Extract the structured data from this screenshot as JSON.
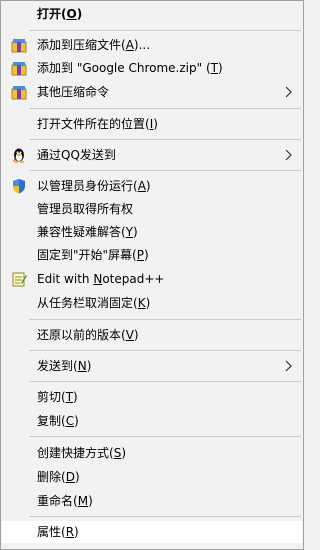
{
  "menu": {
    "open": {
      "label": "打开",
      "key": "O"
    },
    "add_archive": {
      "label": "添加到压缩文件",
      "key": "A",
      "suffix": "..."
    },
    "add_zip": {
      "label": "添加到 \"Google Chrome.zip\" ",
      "key": "T"
    },
    "other_compress": {
      "label": "其他压缩命令"
    },
    "open_location": {
      "label": "打开文件所在的位置",
      "key": "I"
    },
    "send_qq": {
      "label": "通过QQ发送到"
    },
    "run_admin": {
      "label": "以管理员身份运行",
      "key": "A"
    },
    "take_ownership": {
      "label": "管理员取得所有权"
    },
    "compat": {
      "label": "兼容性疑难解答",
      "key": "Y"
    },
    "pin_start": {
      "label": "固定到\"开始\"屏幕",
      "key": "P"
    },
    "notepad": {
      "label_pre": "Edit with ",
      "label_ul": "N",
      "label_post": "otepad++"
    },
    "unpin_taskbar": {
      "label": "从任务栏取消固定",
      "key": "K"
    },
    "restore": {
      "label": "还原以前的版本",
      "key": "V"
    },
    "send_to": {
      "label": "发送到",
      "key": "N"
    },
    "cut": {
      "label": "剪切",
      "key": "T"
    },
    "copy": {
      "label": "复制",
      "key": "C"
    },
    "shortcut": {
      "label": "创建快捷方式",
      "key": "S"
    },
    "delete": {
      "label": "删除",
      "key": "D"
    },
    "rename": {
      "label": "重命名",
      "key": "M"
    },
    "properties": {
      "label": "属性",
      "key": "R"
    }
  },
  "colors": {
    "background": "#f2f2f2",
    "separator": "#cccccc",
    "hover": "#ffffff"
  }
}
